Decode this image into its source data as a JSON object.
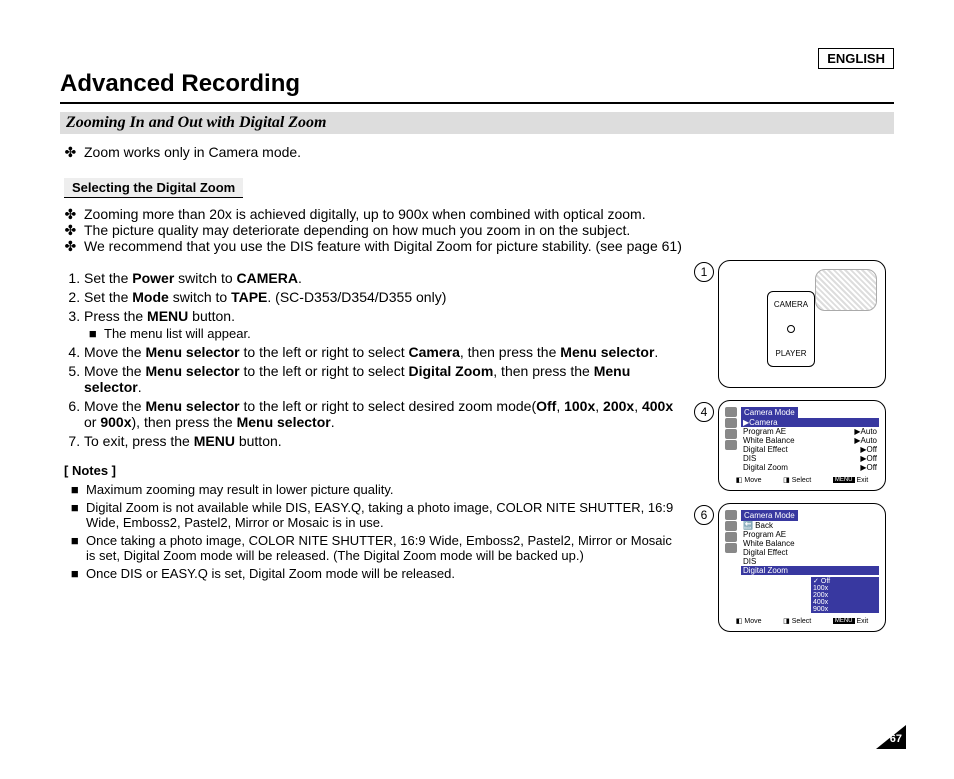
{
  "lang": "ENGLISH",
  "title": "Advanced Recording",
  "subtitle": "Zooming In and Out with Digital Zoom",
  "intro": [
    "Zoom works only in Camera mode."
  ],
  "subhead": "Selecting the Digital Zoom",
  "bullets2": [
    "Zooming more than 20x is achieved digitally, up to 900x when combined with optical zoom.",
    "The picture quality may deteriorate depending on how much you zoom in on the subject.",
    "We recommend that you use the DIS feature with Digital Zoom for picture stability. (see page 61)"
  ],
  "steps": {
    "s1a": "Set the ",
    "s1b": "Power",
    "s1c": " switch to ",
    "s1d": "CAMERA",
    "s1e": ".",
    "s2a": "Set the ",
    "s2b": "Mode",
    "s2c": " switch to ",
    "s2d": "TAPE",
    "s2e": ". (SC-D353/D354/D355 only)",
    "s3a": "Press the ",
    "s3b": "MENU",
    "s3c": " button.",
    "s3sub": "The menu list will appear.",
    "s4a": "Move the ",
    "s4b": "Menu selector",
    "s4c": " to the left or right to select ",
    "s4d": "Camera",
    "s4e": ", then press the ",
    "s4f": "Menu selector",
    "s4g": ".",
    "s5a": "Move the ",
    "s5b": "Menu selector",
    "s5c": " to the left or right to select ",
    "s5d": "Digital Zoom",
    "s5e": ", then press the ",
    "s5f": "Menu selector",
    "s5g": ".",
    "s6a": "Move the ",
    "s6b": "Menu selector",
    "s6c": " to the left or right to select desired zoom mode(",
    "s6d": "Off",
    "s6e": ", ",
    "s6f": "100x",
    "s6g": ", ",
    "s6h": "200x",
    "s6i": ", ",
    "s6j": "400x",
    "s6k": " or ",
    "s6l": "900x",
    "s6m": "), then press the ",
    "s6n": "Menu selector",
    "s6o": ".",
    "s7a": "To exit, press the ",
    "s7b": "MENU",
    "s7c": " button."
  },
  "noteshdr": "[ Notes ]",
  "notes": [
    "Maximum zooming may result in lower picture quality.",
    "Digital Zoom is not available while DIS, EASY.Q, taking a photo image, COLOR NITE SHUTTER, 16:9 Wide, Emboss2, Pastel2, Mirror or Mosaic is in use.",
    "Once taking a photo image, COLOR NITE SHUTTER, 16:9 Wide, Emboss2, Pastel2, Mirror or Mosaic is set, Digital Zoom mode will be released. (The Digital Zoom mode will be backed up.)",
    "Once DIS or EASY.Q is set, Digital Zoom mode will be released."
  ],
  "fig": {
    "n1": "1",
    "n4": "4",
    "n6": "6",
    "camera": "CAMERA",
    "player": "PLAYER",
    "m4": {
      "title": "Camera Mode",
      "sel": "▶Camera",
      "items": [
        [
          "Program AE",
          "▶Auto"
        ],
        [
          "White Balance",
          "▶Auto"
        ],
        [
          "Digital Effect",
          "▶Off"
        ],
        [
          "DIS",
          "▶Off"
        ],
        [
          "Digital Zoom",
          "▶Off"
        ]
      ]
    },
    "m6": {
      "title": "Camera Mode",
      "back": "🔙 Back",
      "items": [
        "Program AE",
        "White Balance",
        "Digital Effect",
        "DIS",
        "Digital Zoom"
      ],
      "opts": [
        "Off",
        "100x",
        "200x",
        "400x",
        "900x"
      ]
    },
    "move": "Move",
    "select": "Select",
    "menu": "MENU",
    "exit": "Exit"
  },
  "pagenum": "67"
}
